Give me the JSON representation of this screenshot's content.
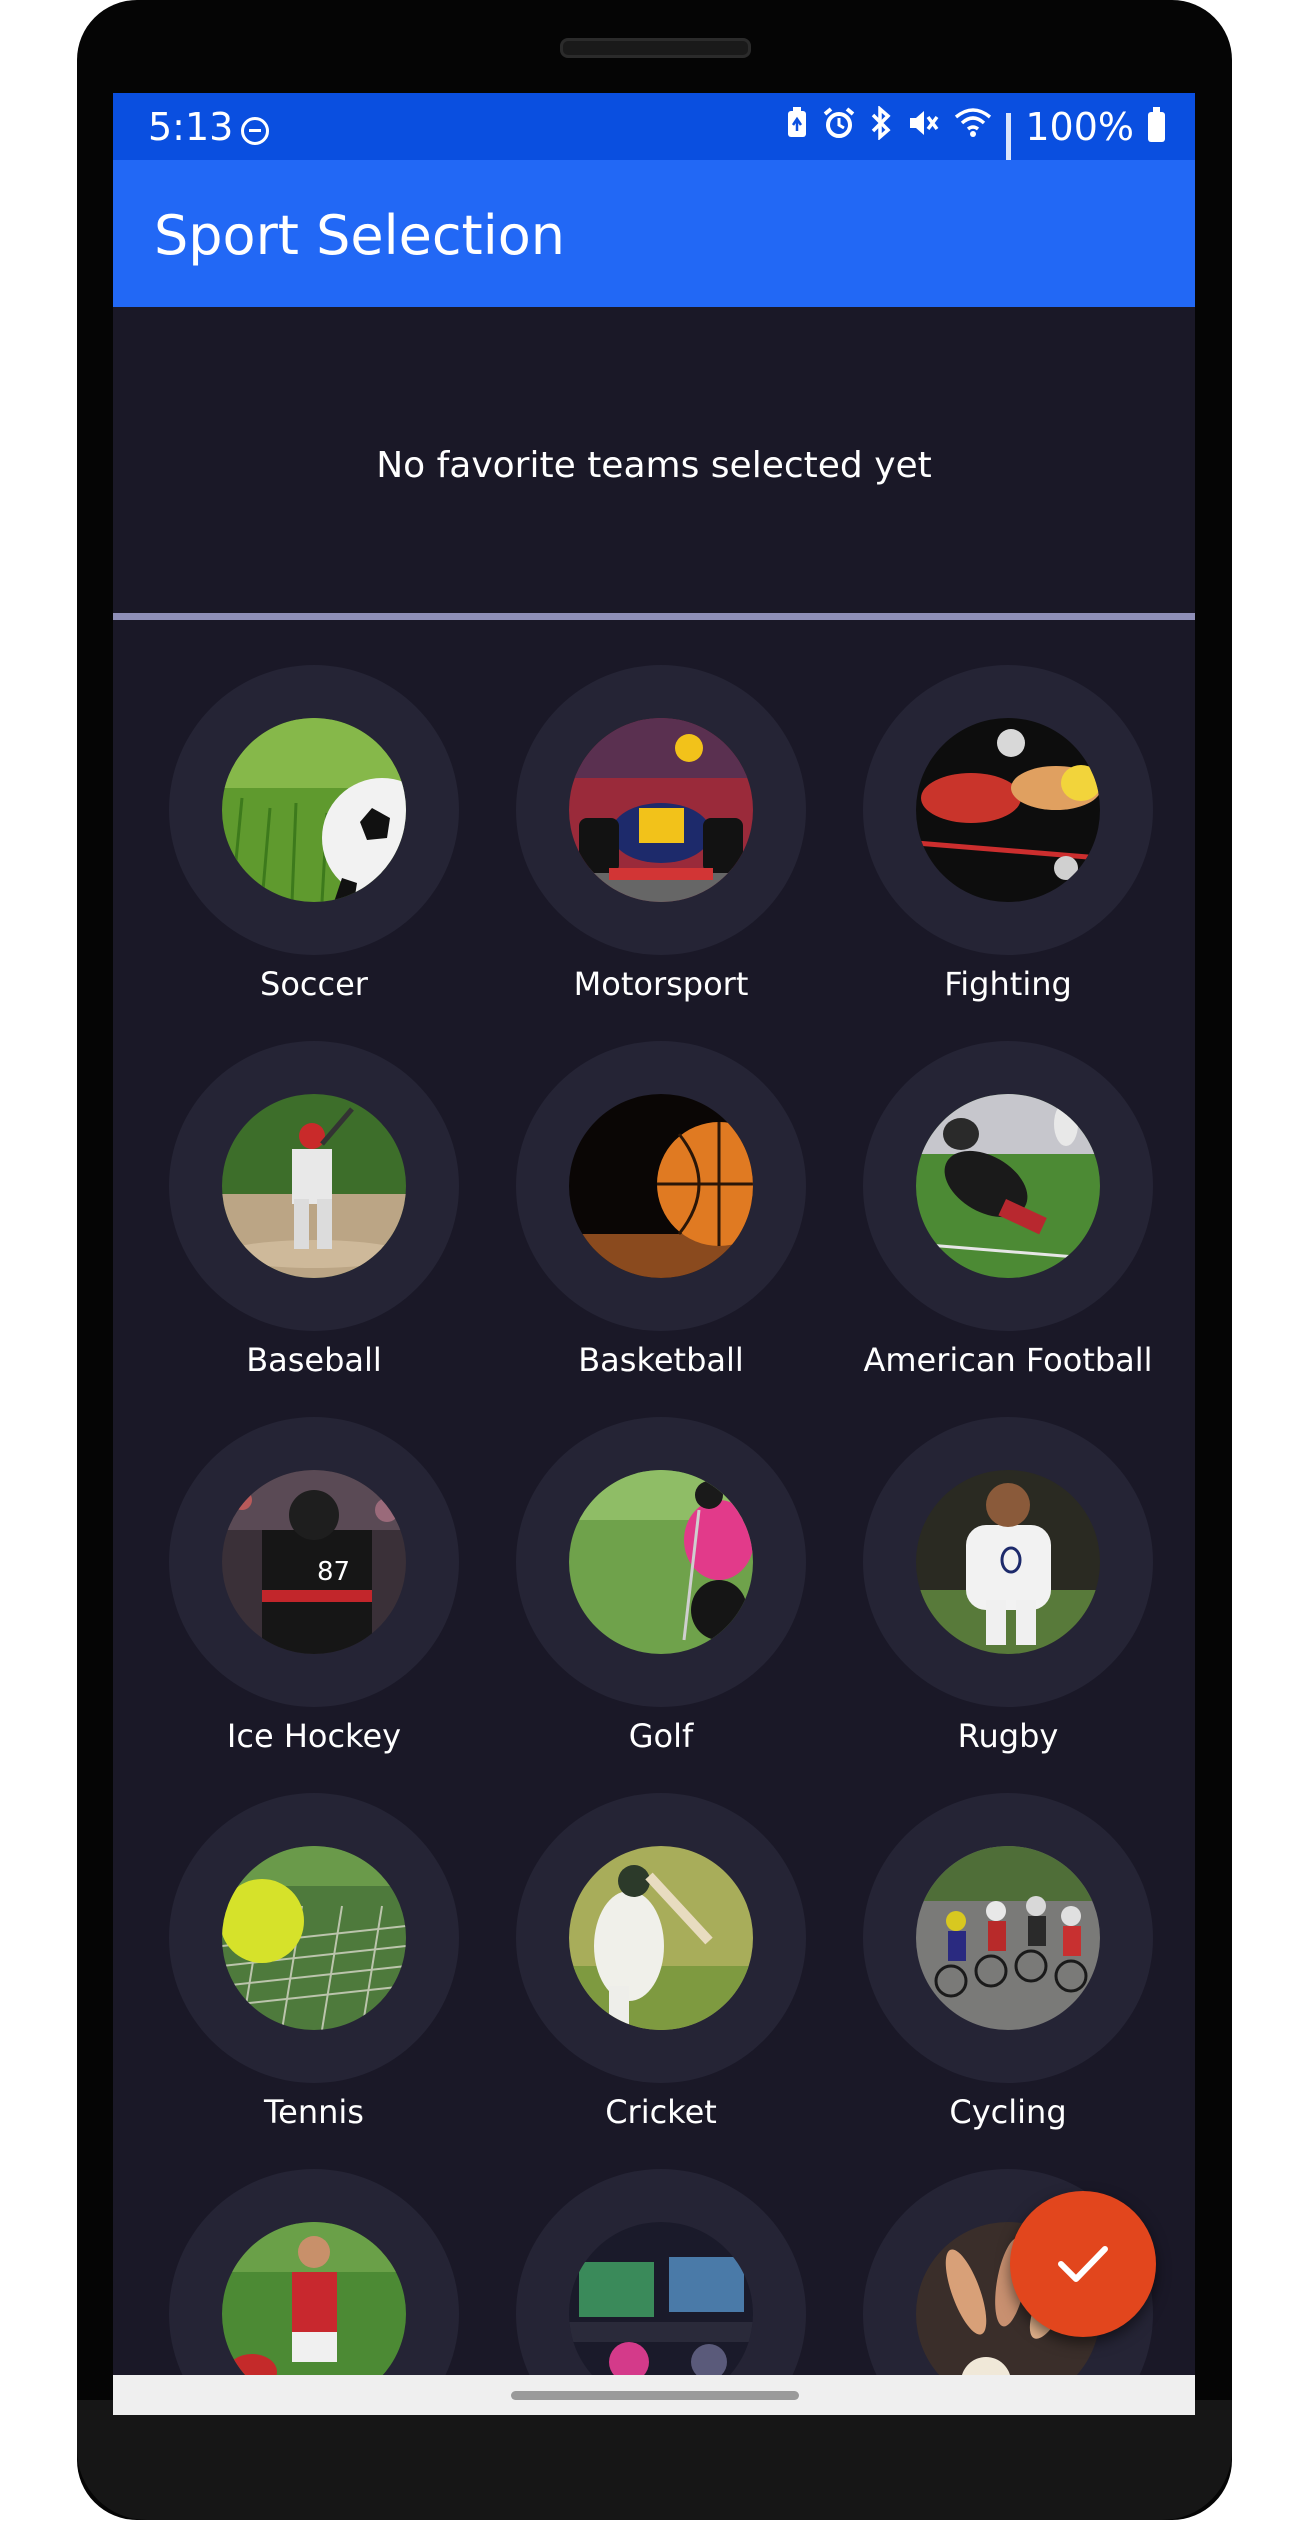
{
  "status_bar": {
    "time": "5:13",
    "battery_percent": "100%",
    "icons": [
      "dnd-icon",
      "battery-saver-icon",
      "alarm-icon",
      "bluetooth-icon",
      "mute-icon",
      "wifi-icon",
      "signal-icon",
      "battery-icon"
    ]
  },
  "app_bar": {
    "title": "Sport Selection"
  },
  "favorites": {
    "empty_message": "No favorite teams selected yet"
  },
  "sports": [
    {
      "label": "Soccer",
      "icon": "soccer-photo"
    },
    {
      "label": "Motorsport",
      "icon": "motorsport-photo"
    },
    {
      "label": "Fighting",
      "icon": "fighting-photo"
    },
    {
      "label": "Baseball",
      "icon": "baseball-photo"
    },
    {
      "label": "Basketball",
      "icon": "basketball-photo"
    },
    {
      "label": "American Football",
      "icon": "american-football-photo"
    },
    {
      "label": "Ice Hockey",
      "icon": "ice-hockey-photo"
    },
    {
      "label": "Golf",
      "icon": "golf-photo"
    },
    {
      "label": "Rugby",
      "icon": "rugby-photo"
    },
    {
      "label": "Tennis",
      "icon": "tennis-photo"
    },
    {
      "label": "Cricket",
      "icon": "cricket-photo"
    },
    {
      "label": "Cycling",
      "icon": "cycling-photo"
    },
    {
      "label": "",
      "icon": "aussie-rules-photo"
    },
    {
      "label": "",
      "icon": "esports-photo"
    },
    {
      "label": "",
      "icon": "volleyball-photo"
    }
  ],
  "fab": {
    "icon": "check-icon"
  },
  "colors": {
    "status_bar": "#0a4fe0",
    "app_bar": "#2268f5",
    "background": "#1a1827",
    "tile_ring": "#252435",
    "divider": "#8f8fb8",
    "fab": "#e2461d"
  }
}
